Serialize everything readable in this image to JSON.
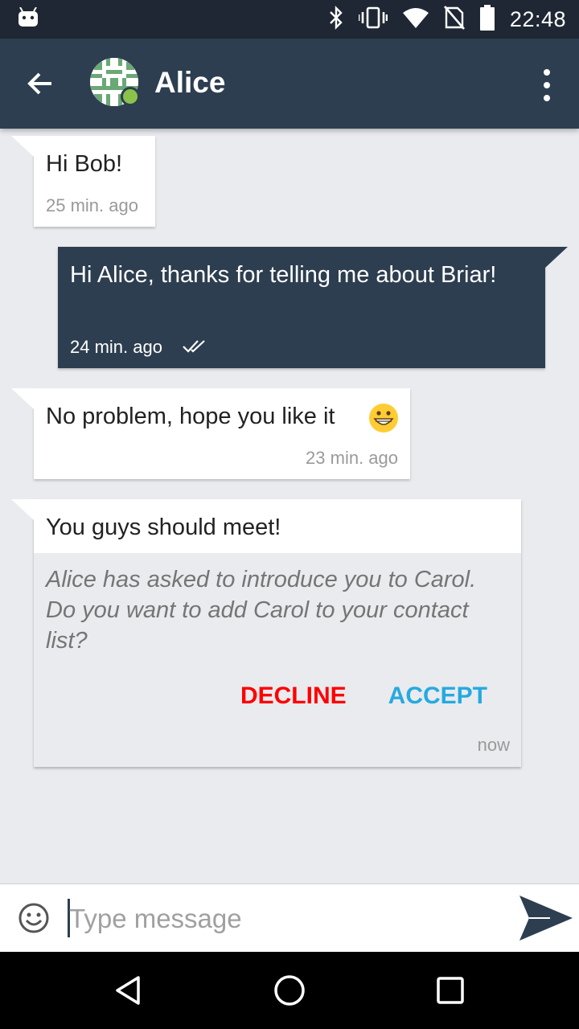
{
  "status_bar": {
    "time": "22:48",
    "icons": [
      "android-icon",
      "bluetooth-icon",
      "vibrate-icon",
      "wifi-icon",
      "no-sim-icon",
      "battery-icon"
    ]
  },
  "toolbar": {
    "back_icon": "arrow-left-icon",
    "contact_name": "Alice",
    "online_color": "#8bc34a",
    "overflow_icon": "more-vert-icon",
    "color": "#2d3e50"
  },
  "messages": [
    {
      "direction": "incoming",
      "text": "Hi Bob!",
      "time": "25 min. ago"
    },
    {
      "direction": "outgoing",
      "text": "Hi Alice, thanks for telling me about Briar!",
      "time": "24 min. ago",
      "status_icon": "double-check-icon"
    },
    {
      "direction": "incoming",
      "text": "No problem, hope you like it",
      "emoji": "grinning-face-icon",
      "time": "23 min. ago"
    }
  ],
  "introduction": {
    "title": "You guys should meet!",
    "body": "Alice has asked to introduce you to Carol. Do you want to add Carol to your contact list?",
    "decline_label": "DECLINE",
    "accept_label": "ACCEPT",
    "decline_color": "#ff0000",
    "accept_color": "#26a9e0",
    "time": "now"
  },
  "input": {
    "placeholder": "Type message",
    "value": "",
    "emoji_icon": "smiley-icon",
    "send_icon": "send-icon"
  },
  "nav": {
    "icons": [
      "nav-back-icon",
      "nav-home-icon",
      "nav-recents-icon"
    ]
  }
}
